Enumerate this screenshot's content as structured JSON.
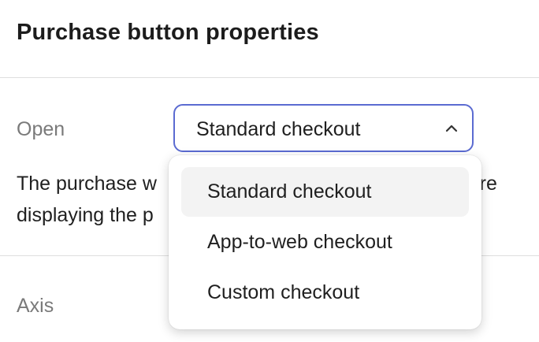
{
  "header": {
    "title": "Purchase button properties"
  },
  "open_field": {
    "label": "Open",
    "selected_value": "Standard checkout",
    "options": [
      "Standard checkout",
      "App-to-web checkout",
      "Custom checkout"
    ]
  },
  "description": {
    "line1_start": "The purchase w",
    "line1_end": "'re",
    "line2_start": "displaying the p"
  },
  "axis": {
    "label": "Axis"
  },
  "colors": {
    "focus_border": "#5b6bd1",
    "selected_option_bg": "#f3f3f3"
  }
}
